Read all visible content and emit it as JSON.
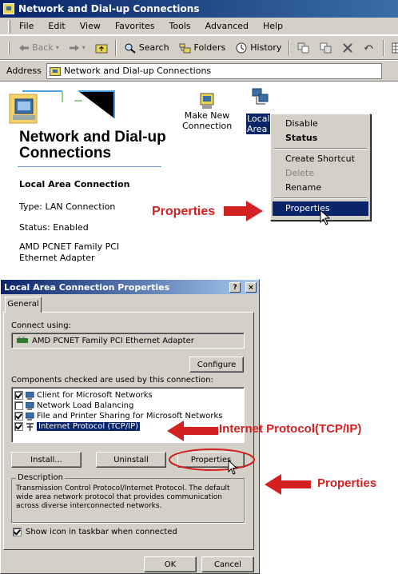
{
  "window": {
    "title": "Network and Dial-up Connections",
    "menu": [
      "File",
      "Edit",
      "View",
      "Favorites",
      "Tools",
      "Advanced",
      "Help"
    ],
    "toolbar": {
      "back": "Back",
      "search": "Search",
      "folders": "Folders",
      "history": "History"
    },
    "address_label": "Address",
    "address_value": "Network and Dial-up Connections"
  },
  "left_panel": {
    "title": "Network and Dial-up Connections",
    "connection_name": "Local Area Connection",
    "type": "Type: LAN Connection",
    "status": "Status: Enabled",
    "adapter": "AMD PCNET Family PCI Ethernet Adapter"
  },
  "icons": {
    "make_new": "Make New Connection",
    "local_area": "Local Area Conne"
  },
  "context_menu": {
    "items": [
      "Disable",
      "Status",
      "Create Shortcut",
      "Delete",
      "Rename",
      "Properties"
    ]
  },
  "callouts": {
    "properties_1": "Properties",
    "tcpip": "Internet Protocol(TCP/IP)",
    "properties_2": "Properties"
  },
  "dialog": {
    "title": "Local Area Connection Properties",
    "help_btn": "?",
    "close_btn": "×",
    "tab": "General",
    "connect_using_label": "Connect using:",
    "adapter": "AMD PCNET Family PCI Ethernet Adapter",
    "configure": "Configure",
    "components_label": "Components checked are used by this connection:",
    "components": [
      {
        "label": "Client for Microsoft Networks",
        "checked": true
      },
      {
        "label": "Network Load Balancing",
        "checked": false
      },
      {
        "label": "File and Printer Sharing for Microsoft Networks",
        "checked": true
      },
      {
        "label": "Internet Protocol (TCP/IP)",
        "checked": true
      }
    ],
    "install": "Install...",
    "uninstall": "Uninstall",
    "properties": "Properties",
    "description_label": "Description",
    "description_text": "Transmission Control Protocol/Internet Protocol. The default wide area network protocol that provides communication across diverse interconnected networks.",
    "show_icon": "Show icon in taskbar when connected",
    "ok": "OK",
    "cancel": "Cancel"
  },
  "colors": {
    "titlebar": "#0a246a",
    "face": "#d4d0c8",
    "callout_red": "#d32020",
    "selection": "#0a246a"
  }
}
